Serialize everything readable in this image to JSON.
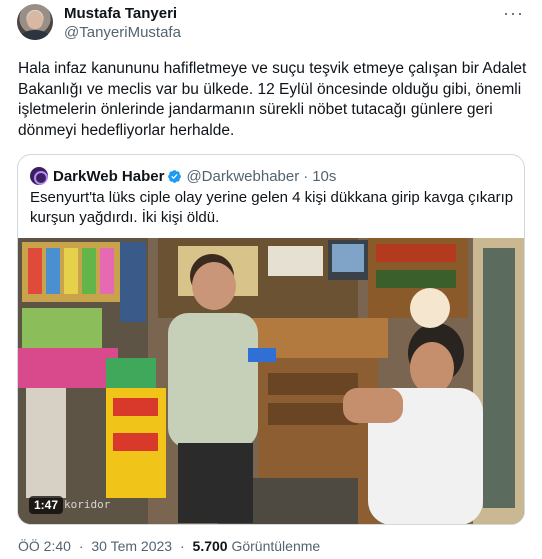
{
  "author": {
    "name": "Mustafa Tanyeri",
    "handle": "@TanyeriMustafa"
  },
  "tweet": {
    "text": "Hala infaz kanununu hafifletmeye ve suçu teşvik etmeye çalışan bir Adalet Bakanlığı ve meclis var bu ülkede. 12 Eylül öncesinde olduğu gibi, önemli işletmelerin önlerinde jandarmanın sürekli nöbet tutacağı günlere geri dönmeyi hedefliyorlar herhalde."
  },
  "quote": {
    "name": "DarkWeb Haber",
    "handle": "@Darkwebhaber",
    "separator": "·",
    "time": "10s",
    "text": "Esenyurt'ta lüks ciple olay yerine gelen 4 kişi dükkana girip kavga çıkarıp kurşun yağdırdı. İki kişi öldü.",
    "video": {
      "duration": "1:47",
      "watermark": "koridor"
    }
  },
  "meta": {
    "time": "ÖÖ 2:40",
    "separator": "·",
    "date": "30 Tem 2023",
    "views_count": "5.700",
    "views_label": "Görüntülenme"
  },
  "colors": {
    "verified": "#1d9bf0",
    "text_secondary": "#536471",
    "border": "#cfd9de"
  },
  "icons": [
    "more-icon",
    "verified-icon",
    "play-duration-badge"
  ]
}
